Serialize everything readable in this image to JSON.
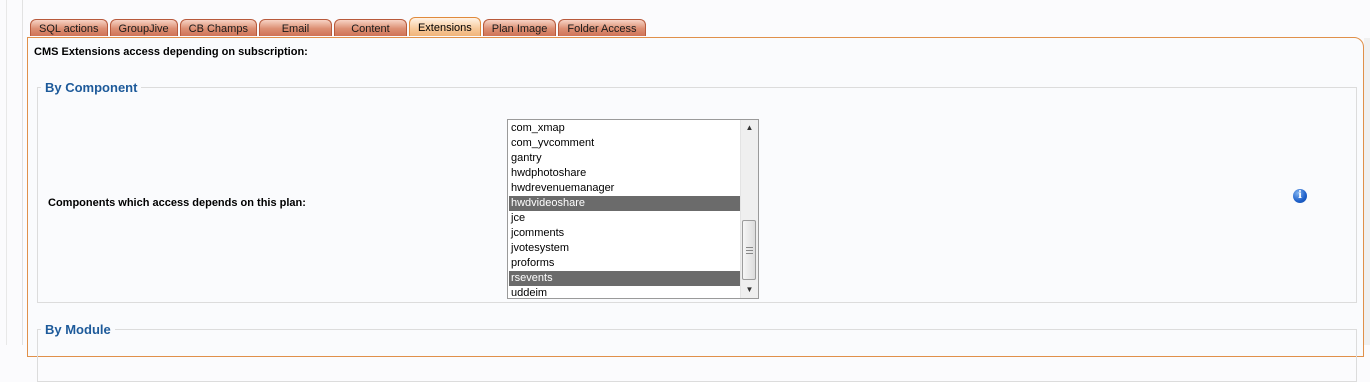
{
  "tabs": [
    {
      "label": "SQL actions",
      "active": false
    },
    {
      "label": "GroupJive",
      "active": false
    },
    {
      "label": "CB Champs",
      "active": false
    },
    {
      "label": "Email",
      "active": false
    },
    {
      "label": "Content",
      "active": false
    },
    {
      "label": "Extensions",
      "active": true
    },
    {
      "label": "Plan Image",
      "active": false
    },
    {
      "label": "Folder Access",
      "active": false
    }
  ],
  "panel": {
    "title": "CMS Extensions access depending on subscription:"
  },
  "by_component": {
    "legend": "By Component",
    "field_label": "Components which access depends on this plan:",
    "items": [
      {
        "label": "com_xmap",
        "selected": false
      },
      {
        "label": "com_yvcomment",
        "selected": false
      },
      {
        "label": "gantry",
        "selected": false
      },
      {
        "label": "hwdphotoshare",
        "selected": false
      },
      {
        "label": "hwdrevenuemanager",
        "selected": false
      },
      {
        "label": "hwdvideoshare",
        "selected": true
      },
      {
        "label": "jce",
        "selected": false
      },
      {
        "label": "jcomments",
        "selected": false
      },
      {
        "label": "jvotesystem",
        "selected": false
      },
      {
        "label": "proforms",
        "selected": false
      },
      {
        "label": "rsevents",
        "selected": true
      },
      {
        "label": "uddeim",
        "selected": false
      }
    ],
    "info_icon": "info-icon"
  },
  "by_module": {
    "legend": "By Module"
  },
  "colors": {
    "tab_active": "#f7c99a",
    "tab_inactive": "#dc8e72",
    "panel_border": "#e0904a",
    "legend_text": "#1d5a9a",
    "selected_item": "#6b6b6b"
  }
}
